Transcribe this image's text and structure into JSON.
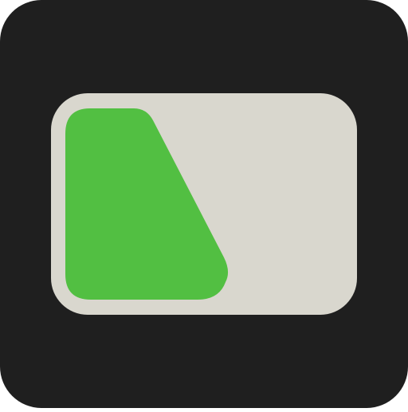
{
  "icon": {
    "name": "app-icon",
    "colors": {
      "background": "#1f1f1f",
      "panel": "#d9d7ce",
      "accent": "#52bf42"
    }
  }
}
